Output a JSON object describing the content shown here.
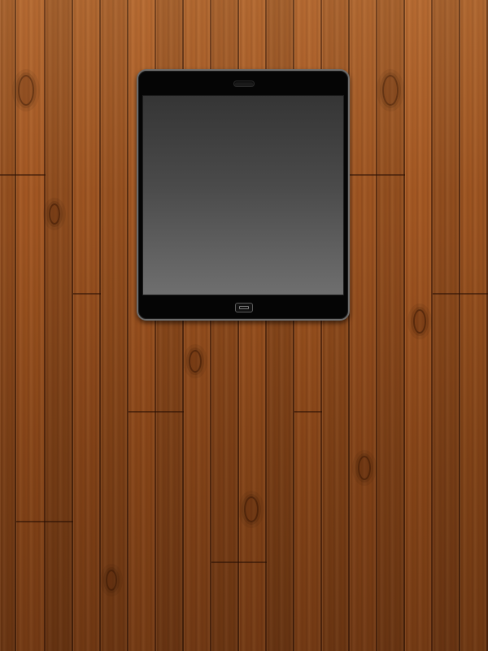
{
  "scene": {
    "background": "wood-plank-surface",
    "device": "tablet"
  },
  "colors": {
    "wood_light": "#a35a26",
    "wood_dark": "#7a3d15",
    "bezel": "#050505",
    "bezel_edge": "#6c6c6c",
    "screen_top": "#353535",
    "screen_bottom": "#6f6f6f"
  },
  "tablet": {
    "screen_state": "blank",
    "speaker_icon": "speaker-grille-icon",
    "home_icon": "home-button-icon"
  }
}
